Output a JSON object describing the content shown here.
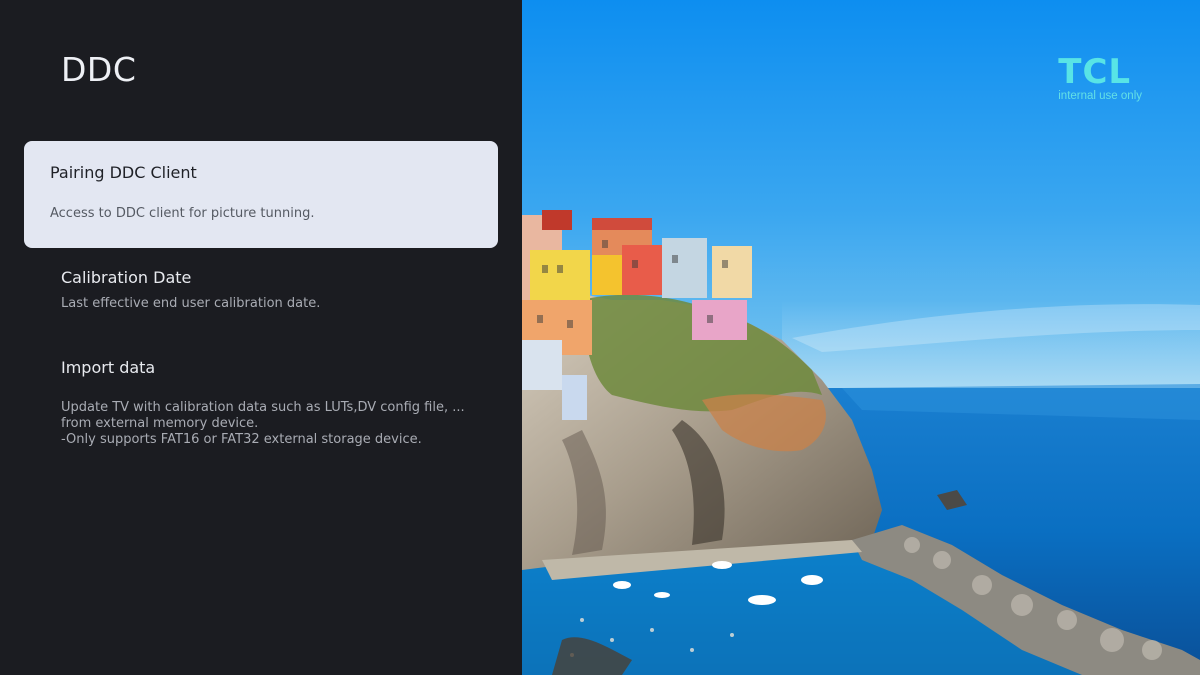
{
  "panel": {
    "title": "DDC",
    "items": [
      {
        "title": "Pairing DDC Client",
        "description": "Access to DDC client for picture tunning.",
        "selected": true
      },
      {
        "title": "Calibration Date",
        "description": "Last effective end user calibration date.",
        "selected": false
      },
      {
        "title": "Import data",
        "description_lines": [
          "Update TV with calibration data such as LUTs,DV config file, ...",
          "from external memory device.",
          "-Only supports FAT16 or FAT32 external storage device."
        ],
        "selected": false
      }
    ]
  },
  "logo": {
    "word": "TCL",
    "subtitle": "internal use only",
    "color": "#58e4e6"
  },
  "colors": {
    "panel_background": "#1b1c21",
    "selected_item_background": "#e3e7f2",
    "sky": "#1e8fe6",
    "sea": "#0b74c9"
  }
}
